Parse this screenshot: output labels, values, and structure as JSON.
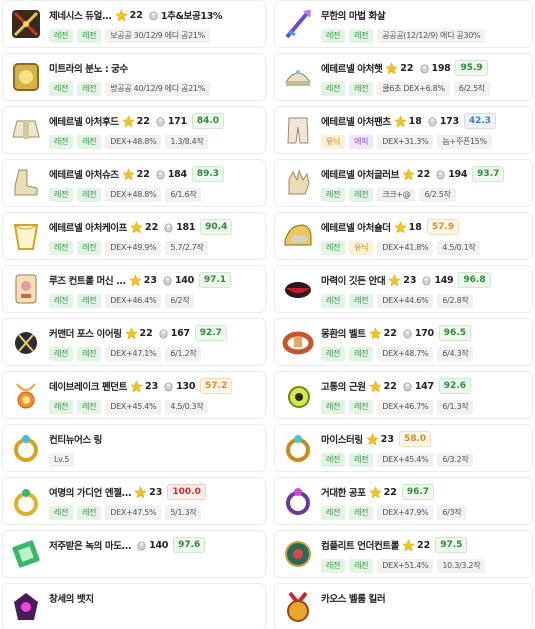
{
  "items": [
    {
      "name": "제네시스 듀얼...",
      "star": "22",
      "upg": "1추&보공13%",
      "score": "",
      "scoreColor": "",
      "tags": [
        {
          "t": "레전",
          "c": "leg"
        },
        {
          "t": "레전",
          "c": "leg"
        },
        {
          "t": "보공공 30/12/9 에디 공21%",
          "c": "grey"
        }
      ],
      "icon": "weapon"
    },
    {
      "name": "무한의 마법 화살",
      "star": "",
      "upg": "",
      "score": "",
      "scoreColor": "",
      "tags": [
        {
          "t": "레전",
          "c": "leg"
        },
        {
          "t": "레전",
          "c": "leg"
        },
        {
          "t": "공공공(12/12/9) 에디 공30%",
          "c": "grey"
        }
      ],
      "icon": "arrow"
    },
    {
      "name": "미트라의 분노 : 궁수",
      "star": "",
      "upg": "",
      "score": "",
      "scoreColor": "",
      "tags": [
        {
          "t": "레전",
          "c": "leg"
        },
        {
          "t": "레전",
          "c": "leg"
        },
        {
          "t": "방공공 40/12/9 에디 공21%",
          "c": "grey"
        }
      ],
      "icon": "emblem"
    },
    {
      "name": "에테르넬 아처햇",
      "star": "22",
      "upg": "198",
      "score": "95.9",
      "scoreColor": "green",
      "tags": [
        {
          "t": "레전",
          "c": "leg"
        },
        {
          "t": "레전",
          "c": "leg"
        },
        {
          "t": "쿨6초 DEX+6.8%",
          "c": "grey"
        },
        {
          "t": "6/2.5작",
          "c": "grey"
        }
      ],
      "icon": "hat"
    },
    {
      "name": "에테르넬 아처후드",
      "star": "22",
      "upg": "171",
      "score": "84.0",
      "scoreColor": "green",
      "tags": [
        {
          "t": "레전",
          "c": "leg"
        },
        {
          "t": "레전",
          "c": "leg"
        },
        {
          "t": "DEX+48.8%",
          "c": "grey"
        },
        {
          "t": "1.3/8.4작",
          "c": "grey"
        }
      ],
      "icon": "top"
    },
    {
      "name": "에테르넬 아처팬츠",
      "star": "18",
      "upg": "173",
      "score": "42.3",
      "scoreColor": "blue",
      "tags": [
        {
          "t": "유닉",
          "c": "uni"
        },
        {
          "t": "에픽",
          "c": "epic"
        },
        {
          "t": "DEX+31.3%",
          "c": "grey"
        },
        {
          "t": "놈+주픈15%",
          "c": "grey"
        }
      ],
      "icon": "pants"
    },
    {
      "name": "에테르넬 아처슈즈",
      "star": "22",
      "upg": "184",
      "score": "89.3",
      "scoreColor": "green",
      "tags": [
        {
          "t": "레전",
          "c": "leg"
        },
        {
          "t": "레전",
          "c": "leg"
        },
        {
          "t": "DEX+48.8%",
          "c": "grey"
        },
        {
          "t": "6/1.6작",
          "c": "grey"
        }
      ],
      "icon": "shoes"
    },
    {
      "name": "에테르넬 아처글러브",
      "star": "22",
      "upg": "194",
      "score": "93.7",
      "scoreColor": "green",
      "tags": [
        {
          "t": "레전",
          "c": "leg"
        },
        {
          "t": "레전",
          "c": "leg"
        },
        {
          "t": "크크+@",
          "c": "grey"
        },
        {
          "t": "6/2.5작",
          "c": "grey"
        }
      ],
      "icon": "glove"
    },
    {
      "name": "에테르넬 아처케이프",
      "star": "22",
      "upg": "181",
      "score": "90.4",
      "scoreColor": "green",
      "tags": [
        {
          "t": "레전",
          "c": "leg"
        },
        {
          "t": "레전",
          "c": "leg"
        },
        {
          "t": "DEX+49.9%",
          "c": "grey"
        },
        {
          "t": "5.7/2.7작",
          "c": "grey"
        }
      ],
      "icon": "cape"
    },
    {
      "name": "에테르넬 아처숄더",
      "star": "18",
      "upg": "",
      "score": "57.9",
      "scoreColor": "orange",
      "tags": [
        {
          "t": "레전",
          "c": "leg"
        },
        {
          "t": "유닉",
          "c": "uni"
        },
        {
          "t": "DEX+41.8%",
          "c": "grey"
        },
        {
          "t": "4.5/0.1작",
          "c": "grey"
        }
      ],
      "icon": "shoulder"
    },
    {
      "name": "루즈 컨트롤 머신 ...",
      "star": "23",
      "upg": "140",
      "score": "97.1",
      "scoreColor": "green",
      "tags": [
        {
          "t": "레전",
          "c": "leg"
        },
        {
          "t": "레전",
          "c": "leg"
        },
        {
          "t": "DEX+46.4%",
          "c": "grey"
        },
        {
          "t": "6/2작",
          "c": "grey"
        }
      ],
      "icon": "face"
    },
    {
      "name": "마력이 깃든 안대",
      "star": "23",
      "upg": "149",
      "score": "96.8",
      "scoreColor": "green",
      "tags": [
        {
          "t": "레전",
          "c": "leg"
        },
        {
          "t": "레전",
          "c": "leg"
        },
        {
          "t": "DEX+44.6%",
          "c": "grey"
        },
        {
          "t": "6/2.8작",
          "c": "grey"
        }
      ],
      "icon": "eye"
    },
    {
      "name": "커맨더 포스 이어링",
      "star": "22",
      "upg": "167",
      "score": "92.7",
      "scoreColor": "green",
      "tags": [
        {
          "t": "레전",
          "c": "leg"
        },
        {
          "t": "레전",
          "c": "leg"
        },
        {
          "t": "DEX+47.1%",
          "c": "grey"
        },
        {
          "t": "6/1.2작",
          "c": "grey"
        }
      ],
      "icon": "earring"
    },
    {
      "name": "몽환의 벨트",
      "star": "22",
      "upg": "170",
      "score": "96.5",
      "scoreColor": "green",
      "tags": [
        {
          "t": "레전",
          "c": "leg"
        },
        {
          "t": "레전",
          "c": "leg"
        },
        {
          "t": "DEX+48.7%",
          "c": "grey"
        },
        {
          "t": "6/4.3작",
          "c": "grey"
        }
      ],
      "icon": "belt"
    },
    {
      "name": "데이브레이크 펜던트",
      "star": "23",
      "upg": "130",
      "score": "57.2",
      "scoreColor": "orange",
      "tags": [
        {
          "t": "레전",
          "c": "leg"
        },
        {
          "t": "레전",
          "c": "leg"
        },
        {
          "t": "DEX+45.4%",
          "c": "grey"
        },
        {
          "t": "4.5/0.3작",
          "c": "grey"
        }
      ],
      "icon": "pendant"
    },
    {
      "name": "고통의 근원",
      "star": "22",
      "upg": "147",
      "score": "92.6",
      "scoreColor": "green",
      "tags": [
        {
          "t": "레전",
          "c": "leg"
        },
        {
          "t": "레전",
          "c": "leg"
        },
        {
          "t": "DEX+46.7%",
          "c": "grey"
        },
        {
          "t": "6/1.3작",
          "c": "grey"
        }
      ],
      "icon": "pendant2"
    },
    {
      "name": "컨티뉴어스 링",
      "star": "",
      "upg": "",
      "score": "",
      "scoreColor": "",
      "tags": [
        {
          "t": "Lv.5",
          "c": "grey"
        }
      ],
      "icon": "ring"
    },
    {
      "name": "마이스터링",
      "star": "23",
      "upg": "",
      "score": "58.0",
      "scoreColor": "orange",
      "tags": [
        {
          "t": "레전",
          "c": "leg"
        },
        {
          "t": "레전",
          "c": "leg"
        },
        {
          "t": "DEX+45.4%",
          "c": "grey"
        },
        {
          "t": "6/3.2작",
          "c": "grey"
        }
      ],
      "icon": "ring2"
    },
    {
      "name": "여명의 가디언 엔젤...",
      "star": "23",
      "upg": "",
      "score": "100.0",
      "scoreColor": "red",
      "tags": [
        {
          "t": "레전",
          "c": "leg"
        },
        {
          "t": "레전",
          "c": "leg"
        },
        {
          "t": "DEX+47.5%",
          "c": "grey"
        },
        {
          "t": "5/1.3작",
          "c": "grey"
        }
      ],
      "icon": "ring3"
    },
    {
      "name": "거대한 공포",
      "star": "22",
      "upg": "",
      "score": "96.7",
      "scoreColor": "green",
      "tags": [
        {
          "t": "레전",
          "c": "leg"
        },
        {
          "t": "레전",
          "c": "leg"
        },
        {
          "t": "DEX+47.9%",
          "c": "grey"
        },
        {
          "t": "6/3작",
          "c": "grey"
        }
      ],
      "icon": "ring4"
    },
    {
      "name": "저주받은 녹의 마도...",
      "star": "",
      "upg": "140",
      "score": "97.6",
      "scoreColor": "green",
      "tags": [],
      "icon": "book"
    },
    {
      "name": "컴플리트 언더컨트롤",
      "star": "22",
      "upg": "",
      "score": "97.5",
      "scoreColor": "green",
      "tags": [
        {
          "t": "레전",
          "c": "leg"
        },
        {
          "t": "레전",
          "c": "leg"
        },
        {
          "t": "DEX+51.4%",
          "c": "grey"
        },
        {
          "t": "10.3/3.2작",
          "c": "grey"
        }
      ],
      "icon": "gear"
    },
    {
      "name": "창세의 뱃지",
      "star": "",
      "upg": "",
      "score": "",
      "scoreColor": "",
      "tags": [],
      "icon": "badge"
    },
    {
      "name": "카오스 벨룸 킬러",
      "star": "",
      "upg": "",
      "score": "",
      "scoreColor": "",
      "tags": [],
      "icon": "medal"
    }
  ]
}
